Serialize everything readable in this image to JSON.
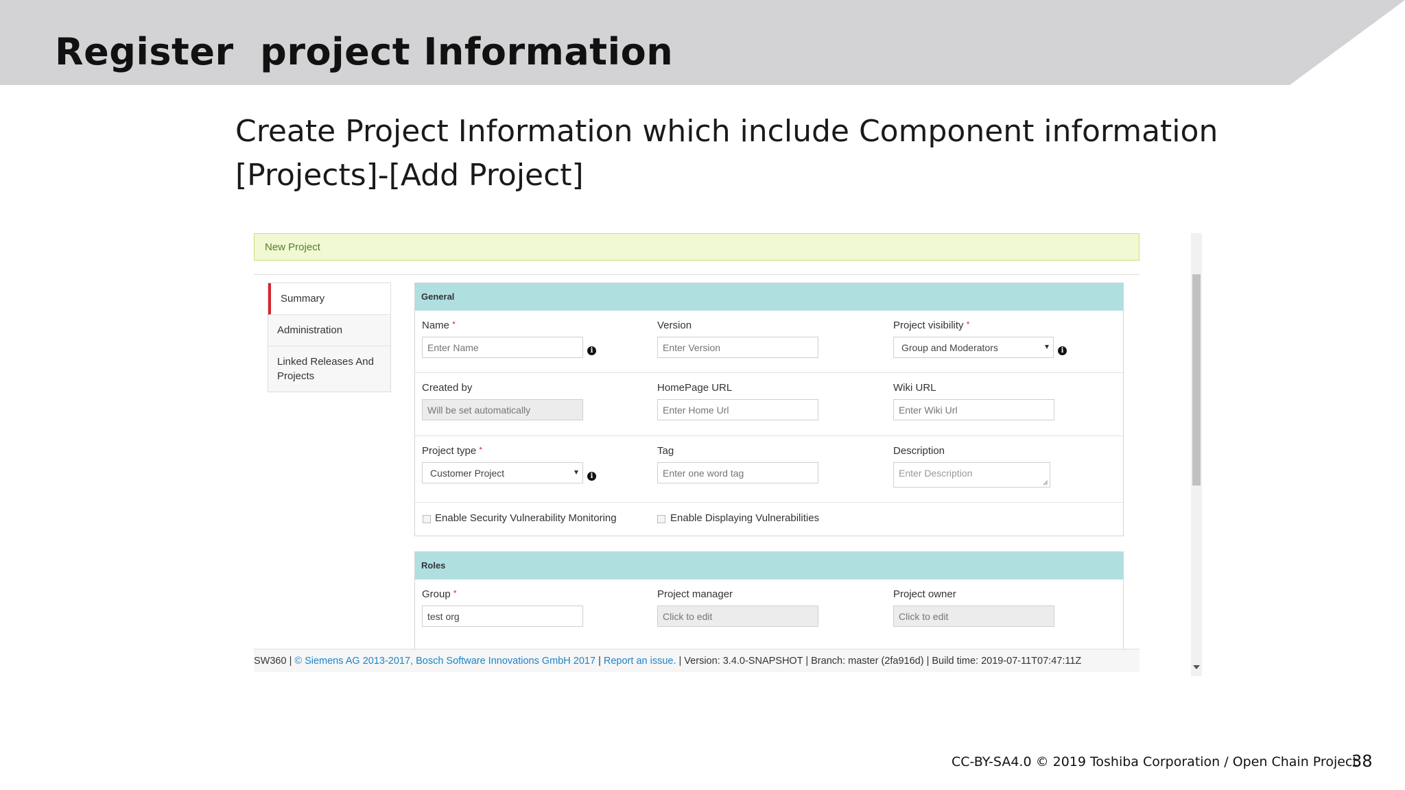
{
  "slide": {
    "title": "Register  project Information",
    "subtitle_line1": "Create Project Information which include Component information",
    "subtitle_line2": "[Projects]-[Add Project]",
    "copyright": "CC-BY-SA4.0 © 2019 Toshiba Corporation / Open Chain Project",
    "page_number": "38",
    "colors": {
      "header_band": "#d3d2d5"
    }
  },
  "app": {
    "header": {
      "label": "New Project"
    },
    "nav": {
      "items": [
        {
          "label": "Summary",
          "active": true
        },
        {
          "label": "Administration"
        },
        {
          "label": "Linked Releases And Projects"
        }
      ]
    },
    "general": {
      "heading": "General",
      "name": {
        "label": "Name",
        "placeholder": "Enter Name"
      },
      "version": {
        "label": "Version",
        "placeholder": "Enter Version"
      },
      "visibility": {
        "label": "Project visibility",
        "value": "Group and Moderators"
      },
      "created_by": {
        "label": "Created by",
        "placeholder": "Will be set automatically"
      },
      "homepage": {
        "label": "HomePage URL",
        "placeholder": "Enter Home Url"
      },
      "wiki": {
        "label": "Wiki URL",
        "placeholder": "Enter Wiki Url"
      },
      "project_type": {
        "label": "Project type",
        "value": "Customer Project"
      },
      "tag": {
        "label": "Tag",
        "placeholder": "Enter one word tag"
      },
      "description": {
        "label": "Description",
        "placeholder": "Enter Description"
      },
      "security_monitoring": {
        "label": "Enable Security Vulnerability Monitoring",
        "checked": false
      },
      "display_vulnerabilities": {
        "label": "Enable Displaying Vulnerabilities",
        "checked": false
      }
    },
    "roles": {
      "heading": "Roles",
      "group": {
        "label": "Group",
        "value": "test org"
      },
      "manager": {
        "label": "Project manager",
        "placeholder": "Click to edit"
      },
      "owner": {
        "label": "Project owner",
        "placeholder": "Click to edit"
      }
    },
    "footer": {
      "prefix": "SW360 | ",
      "link1": "© Siemens AG 2013-2017, Bosch Software Innovations GmbH 2017",
      "sep": " | ",
      "link2": "Report an issue.",
      "rest": " | Version: 3.4.0-SNAPSHOT | Branch: master (2fa916d) | Build time: 2019-07-11T07:47:11Z"
    },
    "required_marker": "*",
    "info_glyph": "i"
  }
}
